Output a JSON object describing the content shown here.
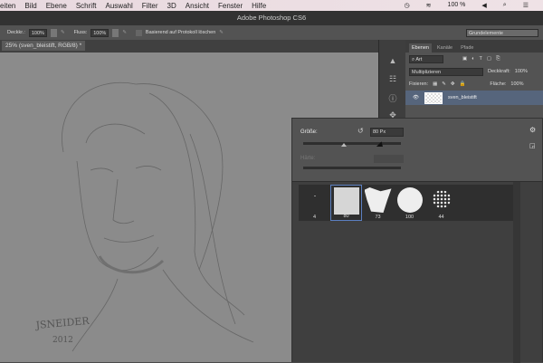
{
  "menubar": {
    "items": [
      "eiten",
      "Bild",
      "Ebene",
      "Schrift",
      "Auswahl",
      "Filter",
      "3D",
      "Ansicht",
      "Fenster",
      "Hilfe"
    ],
    "battery": "100 %"
  },
  "title": "Adobe Photoshop CS6",
  "options": {
    "opacity_label": "Deckkr.:",
    "opacity": "100%",
    "flow_label": "Fluss:",
    "flow": "100%",
    "history_label": "Basierend auf Protokoll löschen",
    "workspace": "Grundelemente"
  },
  "document_tab": "25% (sven_bleistift, RGB/8) *",
  "layers_panel": {
    "tabs": [
      "Ebenen",
      "Kanäle",
      "Pfade"
    ],
    "filter": "Art",
    "blend_mode": "Multiplizieren",
    "opacity_label": "Deckkraft:",
    "opacity": "100%",
    "lock_label": "Fixieren:",
    "fill_label": "Fläche:",
    "fill": "100%",
    "layer_name": "sven_bleistift"
  },
  "brush_popup": {
    "size_label": "Größe:",
    "size_value": "80 Px",
    "size_fraction": 0.42,
    "hardness_label": "Härte:",
    "brushes": [
      {
        "size": "4"
      },
      {
        "size": "80"
      },
      {
        "size": "73"
      },
      {
        "size": "100"
      },
      {
        "size": "44"
      }
    ]
  },
  "signature": "JSNEIDER 2012"
}
